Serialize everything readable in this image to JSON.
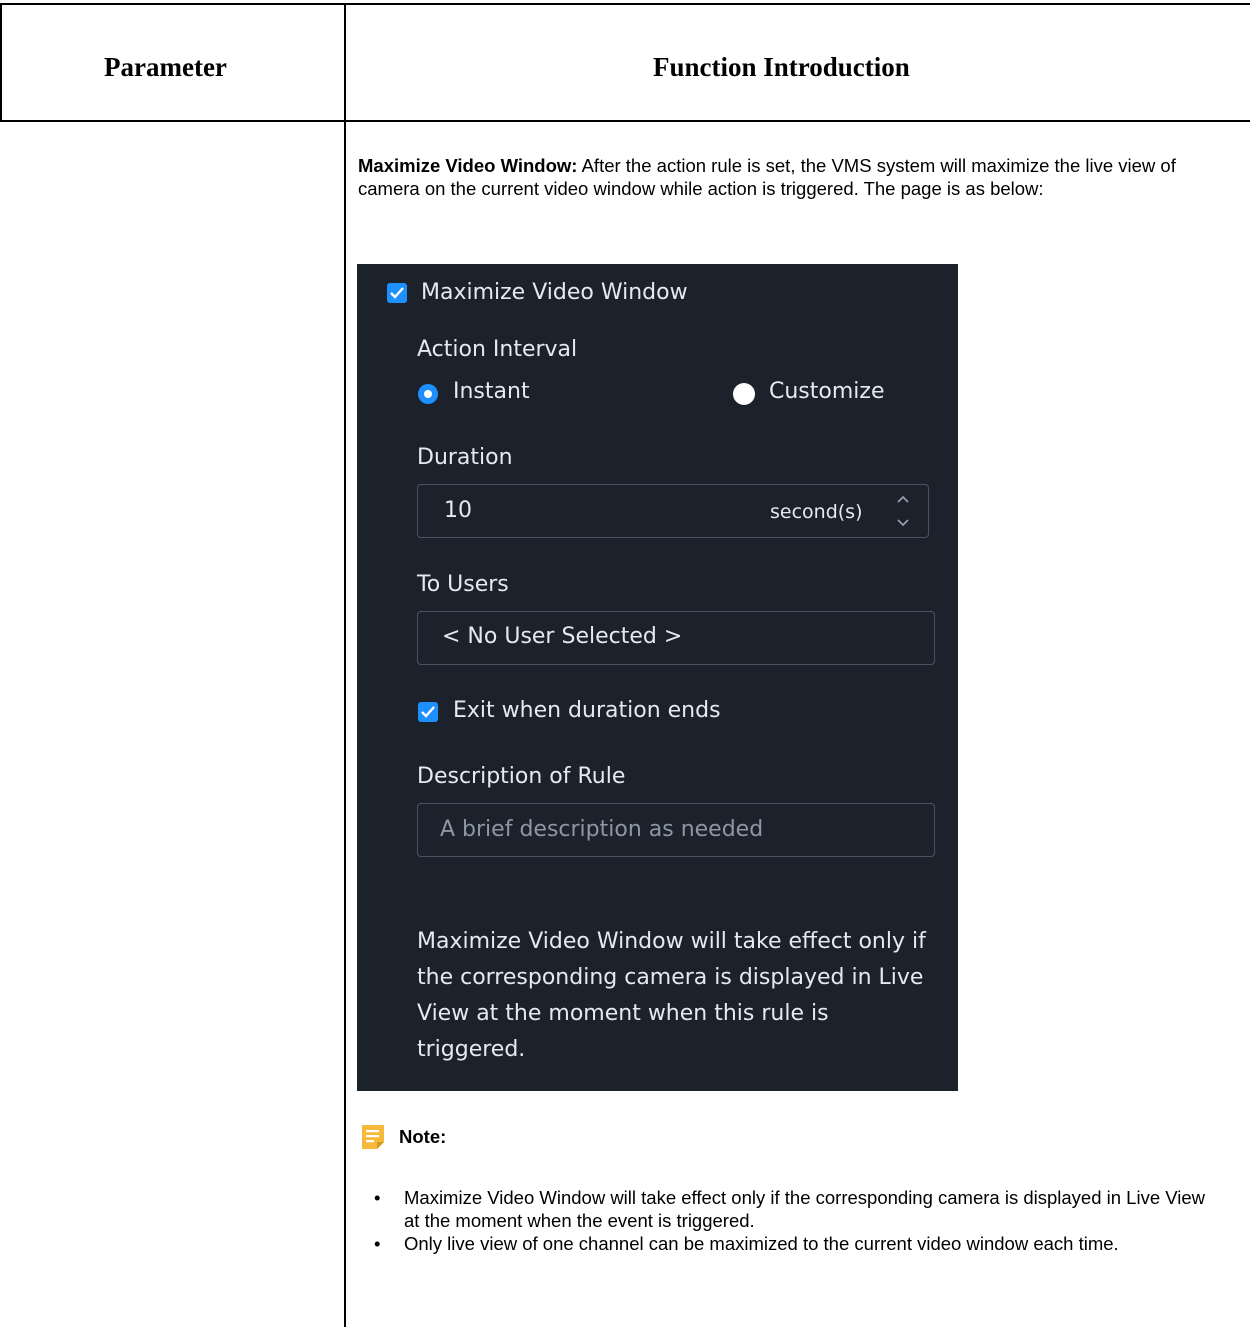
{
  "table": {
    "header_parameter": "Parameter",
    "header_function": "Function Introduction"
  },
  "intro": {
    "bold": "Maximize Video Window:",
    "text": " After the action rule is set, the VMS system will maximize the live view of camera on the current video window while action is triggered. The page is as below:"
  },
  "panel": {
    "colors": {
      "background": "#1c222c",
      "accent": "#1e8fff",
      "border": "#4b5361"
    },
    "maximize_checkbox_label": "Maximize Video Window",
    "maximize_checked": true,
    "action_interval_label": "Action Interval",
    "radio_instant": "Instant",
    "radio_customize": "Customize",
    "selected_interval": "Instant",
    "duration_label": "Duration",
    "duration_value": "10",
    "duration_unit": "second(s)",
    "to_users_label": "To Users",
    "to_users_value": "< No User Selected >",
    "exit_checkbox_label": "Exit when duration ends",
    "exit_checked": true,
    "description_label": "Description of Rule",
    "description_placeholder": "A brief description as needed",
    "notice": "Maximize Video Window will take effect only if the corresponding camera is displayed in Live View at the moment when this rule is triggered."
  },
  "note": {
    "icon": "note-icon",
    "label": "Note:",
    "items": [
      "Maximize Video Window will take effect only if the corresponding camera is displayed in Live View at the moment when the event is triggered.",
      "Only live view of one channel can be maximized to the current video window each time."
    ]
  }
}
